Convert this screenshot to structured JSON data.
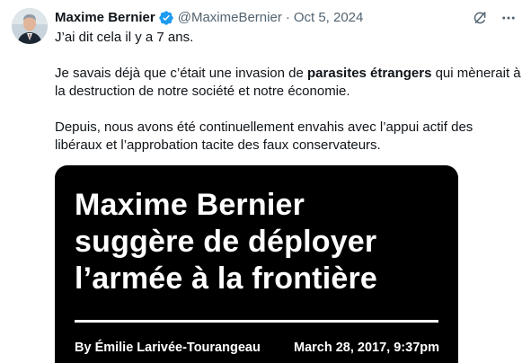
{
  "author": {
    "display_name": "Maxime Bernier",
    "handle": "@MaximeBernier",
    "separator": "·",
    "date": "Oct 5, 2024",
    "verified": true,
    "verified_color": "#1d9bf0"
  },
  "tweet": {
    "para1": "J’ai dit cela il y a 7 ans.",
    "para2_before": "Je savais déjà que c’était une invasion de ",
    "para2_bold": "parasites étrangers",
    "para2_after": " qui mènerait à la destruction de notre société et notre économie.",
    "para3": "Depuis, nous avons été continuellement envahis avec l’appui actif des libéraux et l’approbation tacite des faux conservateurs."
  },
  "media": {
    "headline_line1": "Maxime Bernier",
    "headline_line2": "suggère de déployer",
    "headline_line3": "l’armée à la frontière",
    "byline": "By Émilie Larivée-Tourangeau",
    "byline_date": "March 28, 2017, 9:37pm"
  },
  "icons": {
    "grok": "grok-icon",
    "more": "more-icon",
    "verified": "verified-badge-icon"
  }
}
